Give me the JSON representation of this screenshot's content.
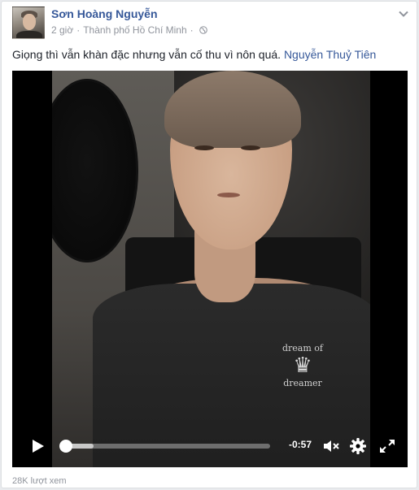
{
  "post": {
    "author": "Sơn Hoàng Nguyễn",
    "time": "2 giờ",
    "location": "Thành phố Hồ Chí Minh",
    "caption_text": "Giọng thì vẫn khàn đặc nhưng vẫn cố thu vì nôn quá.",
    "caption_tag": "Nguyễn Thuỷ Tiên",
    "views": "28K lượt xem"
  },
  "video": {
    "time_remaining": "-0:57",
    "progress": 0.0,
    "buffered": 0.14,
    "shirt_print_top": "dream of",
    "shirt_print_bottom": "dreamer"
  },
  "colors": {
    "link": "#365899",
    "meta": "#90949c",
    "text": "#1d2129"
  },
  "icons": [
    "globe-icon",
    "chevron-down-icon",
    "play-icon",
    "mute-icon",
    "gear-icon",
    "fullscreen-icon"
  ]
}
